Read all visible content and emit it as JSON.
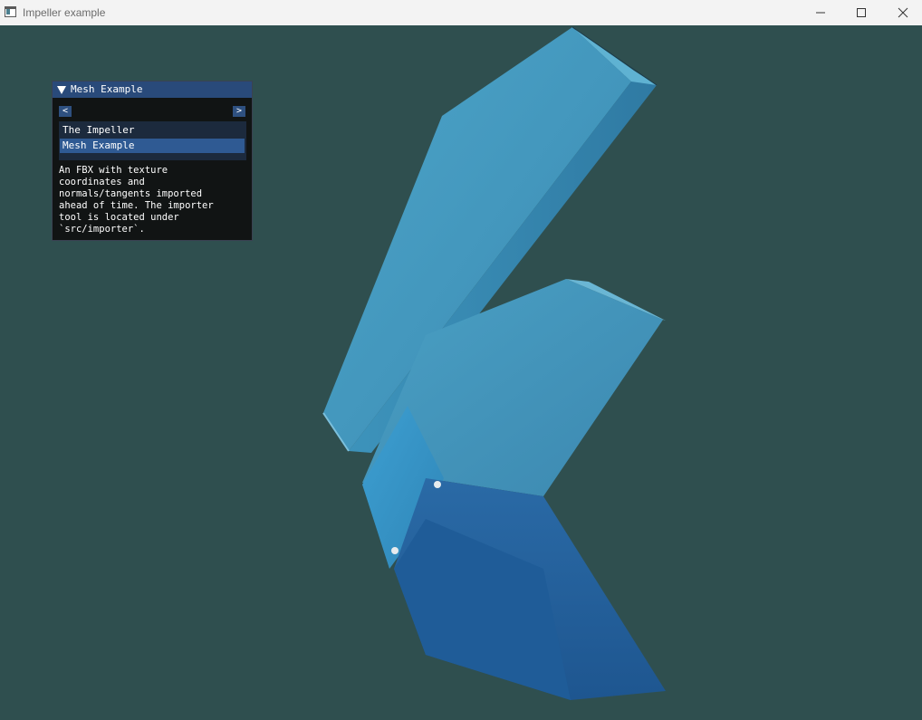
{
  "window": {
    "title": "Impeller example",
    "icon": "app-window-icon",
    "controls": [
      "minimize-icon",
      "maximize-icon",
      "close-icon"
    ]
  },
  "viewport": {
    "background_color": "#2f4f4f",
    "content": "textured-blue-mesh-3d-model",
    "mesh_colors": {
      "light": "#4a9bbf",
      "mid": "#3a84ad",
      "dark": "#1e5d9a"
    }
  },
  "panel": {
    "title": "Mesh Example",
    "prev_label": "<",
    "next_label": ">",
    "items": [
      {
        "label": "The Impeller",
        "selected": false
      },
      {
        "label": "Mesh Example",
        "selected": true
      }
    ],
    "description": "An FBX with texture\ncoordinates and\nnormals/tangents imported\nahead of time. The importer\ntool is located under\n`src/importer`."
  }
}
